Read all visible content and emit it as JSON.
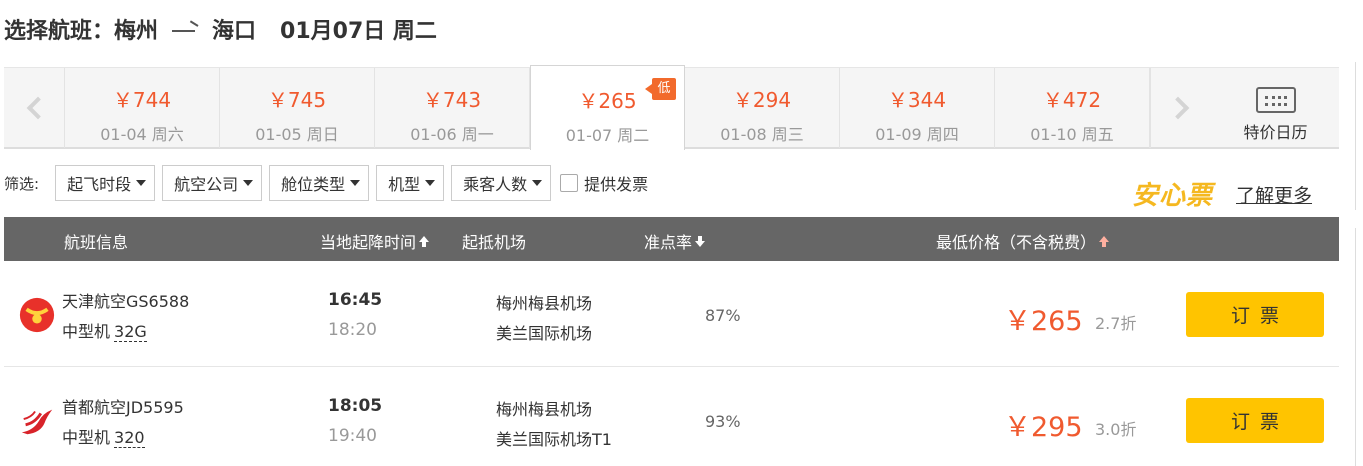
{
  "title": {
    "prefix": "选择航班：",
    "from": "梅州",
    "to": "海口",
    "date": "01月07日 周二"
  },
  "days": [
    {
      "price": "￥744",
      "date": "01-04 周六"
    },
    {
      "price": "￥745",
      "date": "01-05 周日"
    },
    {
      "price": "￥743",
      "date": "01-06 周一"
    },
    {
      "price": "￥265",
      "date": "01-07 周二",
      "active": true,
      "badge": "低"
    },
    {
      "price": "￥294",
      "date": "01-08 周三"
    },
    {
      "price": "￥344",
      "date": "01-09 周四"
    },
    {
      "price": "￥472",
      "date": "01-10 周五"
    }
  ],
  "calendar_label": "特价日历",
  "filters": {
    "label": "筛选:",
    "buttons": [
      "起飞时段",
      "航空公司",
      "舱位类型",
      "机型",
      "乘客人数"
    ],
    "invoice": "提供发票"
  },
  "anxin": "安心票",
  "learn_more": "了解更多",
  "columns": {
    "flight": "航班信息",
    "time": "当地起降时间",
    "airport": "起抵机场",
    "ontime": "准点率",
    "price": "最低价格（不含税费）"
  },
  "flights": [
    {
      "airline": "天津航空GS6588",
      "craft": "中型机",
      "model": "32G",
      "dep": "16:45",
      "arr": "18:20",
      "dep_airport": "梅州梅县机场",
      "arr_airport": "美兰国际机场",
      "ontime": "87%",
      "price": "￥265",
      "discount": "2.7折",
      "book": "订票"
    },
    {
      "airline": "首都航空JD5595",
      "craft": "中型机",
      "model": "320",
      "dep": "18:05",
      "arr": "19:40",
      "dep_airport": "梅州梅县机场",
      "arr_airport": "美兰国际机场T1",
      "ontime": "93%",
      "price": "￥295",
      "discount": "3.0折",
      "book": "订票"
    }
  ],
  "colors": {
    "price": "#f05a2f",
    "book_button": "#ffc400",
    "header_bg": "#666666",
    "anxin": "#f5b820"
  }
}
